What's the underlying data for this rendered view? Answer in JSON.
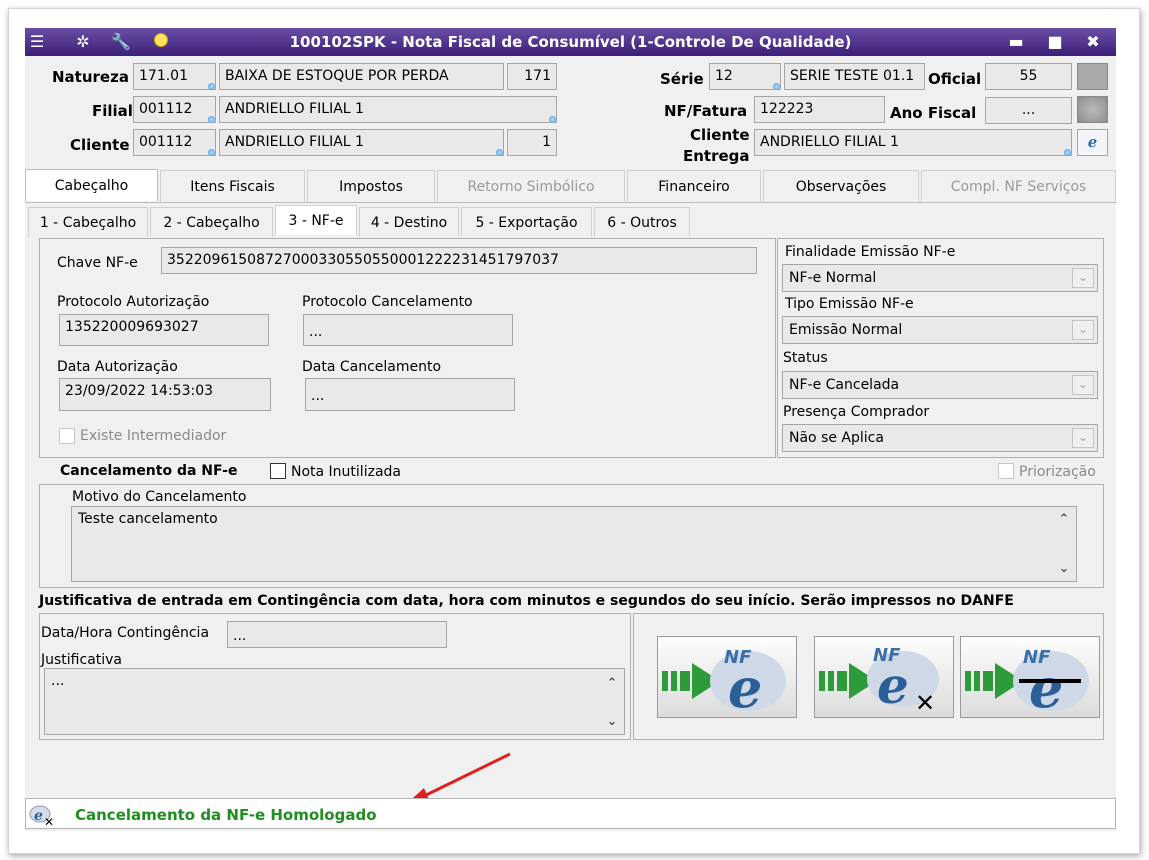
{
  "window": {
    "title": "100102SPK - Nota Fiscal de Consumível (1-Controle De Qualidade)",
    "controls": {
      "minimize": "▬",
      "maximize": "■",
      "close": "✖"
    }
  },
  "header": {
    "natureza_label": "Natureza",
    "natureza_code": "171.01",
    "natureza_desc": "BAIXA DE ESTOQUE POR PERDA",
    "natureza_num": "171",
    "filial_label": "Filial",
    "filial_code": "001112",
    "filial_desc": "ANDRIELLO FILIAL 1",
    "cliente_label": "Cliente",
    "cliente_code": "001112",
    "cliente_desc": "ANDRIELLO FILIAL 1",
    "cliente_num": "1",
    "serie_label": "Série",
    "serie_code": "12",
    "serie_desc": "SERIE TESTE 01.1",
    "oficial_label": "Oficial",
    "oficial_value": "55",
    "nf_label": "NF/Fatura",
    "nf_value": "122223",
    "ano_label": "Ano Fiscal",
    "ano_value": "...",
    "cliente_entrega_label_1": "Cliente",
    "cliente_entrega_label_2": "Entrega",
    "cliente_entrega_value": "ANDRIELLO FILIAL 1"
  },
  "tabs": [
    "Cabeçalho",
    "Itens Fiscais",
    "Impostos",
    "Retorno Simbólico",
    "Financeiro",
    "Observações",
    "Compl. NF Serviços"
  ],
  "subtabs": [
    "1 - Cabeçalho",
    "2 - Cabeçalho",
    "3 - NF-e",
    "4 - Destino",
    "5 - Exportação",
    "6 - Outros"
  ],
  "nfe": {
    "chave_label": "Chave NF-e",
    "chave_value": "35220961508727000330550550001222231451797037",
    "protocolo_aut_label": "Protocolo Autorização",
    "protocolo_aut_value": "135220009693027",
    "protocolo_canc_label": "Protocolo Cancelamento",
    "protocolo_canc_value": "...",
    "data_aut_label": "Data Autorização",
    "data_aut_value": "23/09/2022 14:53:03",
    "data_canc_label": "Data Cancelamento",
    "data_canc_value": "...",
    "intermediador_label": "Existe Intermediador",
    "finalidade_label": "Finalidade Emissão NF-e",
    "finalidade_value": "NF-e Normal",
    "tipo_label": "Tipo Emissão NF-e",
    "tipo_value": "Emissão Normal",
    "status_label": "Status",
    "status_value": "NF-e Cancelada",
    "presenca_label": "Presença Comprador",
    "presenca_value": "Não se Aplica"
  },
  "cancelamento": {
    "title": "Cancelamento da NF-e",
    "inutilizada_label": "Nota Inutilizada",
    "priorizacao_label": "Priorização",
    "motivo_label": "Motivo do Cancelamento",
    "motivo_value": "Teste  cancelamento"
  },
  "contingencia": {
    "title": "Justificativa de entrada em Contingência com data, hora com minutos e segundos do seu início. Serão impressos no DANFE",
    "data_label": "Data/Hora Contingência",
    "data_value": "...",
    "justificativa_label": "Justificativa",
    "justificativa_value": "..."
  },
  "nfe_buttons": {
    "logo_text": "NF",
    "logo_letter": "e",
    "cancel_mark": "✕"
  },
  "scroll": {
    "up": "⌃",
    "down": "⌄"
  },
  "statusbar": {
    "message": "Cancelamento da NF-e Homologado",
    "color": "#1e8f1e"
  },
  "colors": {
    "title_bar": "#4b2f8f",
    "arrow": "#e02020"
  }
}
